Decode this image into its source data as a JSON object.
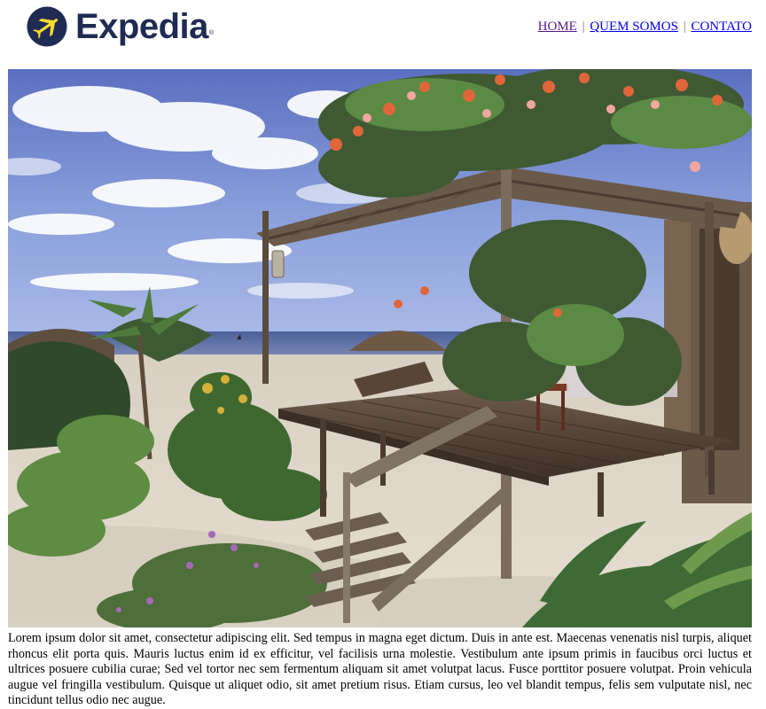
{
  "header": {
    "logo": {
      "brand": "Expedia",
      "trademark": "®",
      "icon": "airplane-logo-icon",
      "color": "#1f2b52"
    },
    "nav": {
      "items": [
        {
          "label": "HOME",
          "visited": true
        },
        {
          "label": "QUEM SOMOS",
          "visited": false
        },
        {
          "label": "CONTATO",
          "visited": false
        }
      ],
      "separator": "|",
      "link_color": "#0000ee",
      "visited_color": "#551a8b"
    }
  },
  "hero": {
    "scene": "beach-bungalow-photo"
  },
  "content": {
    "paragraph": "Lorem ipsum dolor sit amet, consectetur adipiscing elit. Sed tempus in magna eget dictum. Duis in ante est. Maecenas venenatis nisl turpis, aliquet rhoncus elit porta quis. Mauris luctus enim id ex efficitur, vel facilisis urna molestie. Vestibulum ante ipsum primis in faucibus orci luctus et ultrices posuere cubilia curae; Sed vel tortor nec sem fermentum aliquam sit amet volutpat lacus. Fusce porttitor posuere volutpat. Proin vehicula augue vel fringilla vestibulum. Quisque ut aliquet odio, sit amet pretium risus. Etiam cursus, leo vel blandit tempus, felis sem vulputate nisl, nec tincidunt tellus odio nec augue."
  }
}
